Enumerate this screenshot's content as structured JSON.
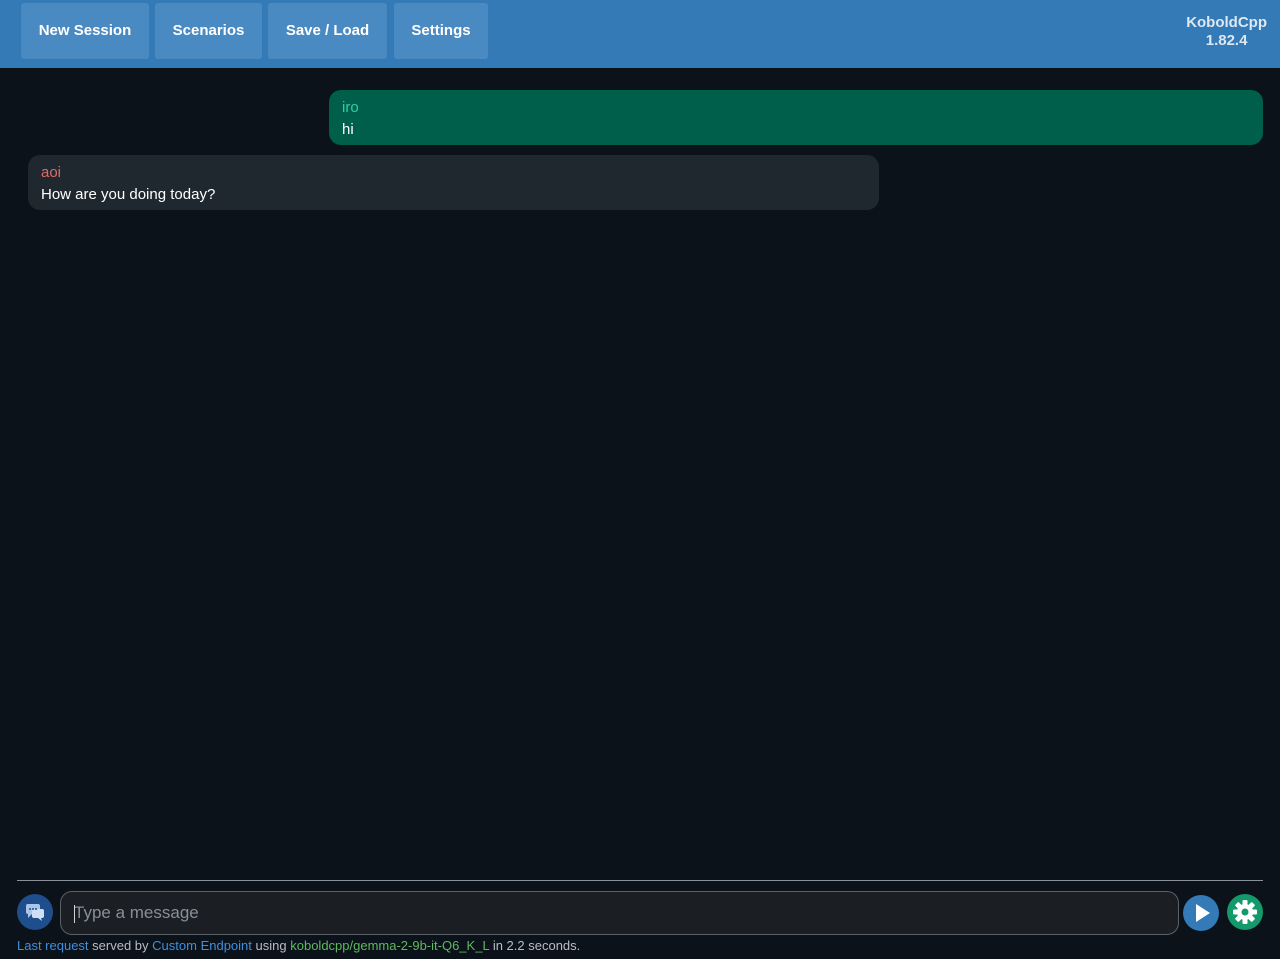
{
  "nav": {
    "new_session": "New Session",
    "scenarios": "Scenarios",
    "save_load": "Save / Load",
    "settings": "Settings"
  },
  "brand": {
    "name": "KoboldCpp",
    "version": "1.82.4"
  },
  "messages": [
    {
      "sender": "iro",
      "text": "hi",
      "side": "right"
    },
    {
      "sender": "aoi",
      "text": "How are you doing today?",
      "side": "left"
    }
  ],
  "input": {
    "placeholder": "Type a message",
    "value": ""
  },
  "icons": {
    "mode": "chat-bubbles-icon",
    "send": "play-icon",
    "settings": "gear-icon"
  },
  "colors": {
    "topbar": "#337ab7",
    "user_bubble": "#005f4b",
    "user_name": "#2ad1a0",
    "ai_bubble": "#1f282f",
    "ai_name": "#e06a6a",
    "send_button": "#337ab7",
    "settings_button": "#13996b"
  },
  "status": {
    "last_request": "Last request",
    "served_by": "served by",
    "endpoint": "Custom Endpoint",
    "using": "using",
    "model": "koboldcpp/gemma-2-9b-it-Q6_K_L",
    "time_text": "in 2.2 seconds."
  }
}
